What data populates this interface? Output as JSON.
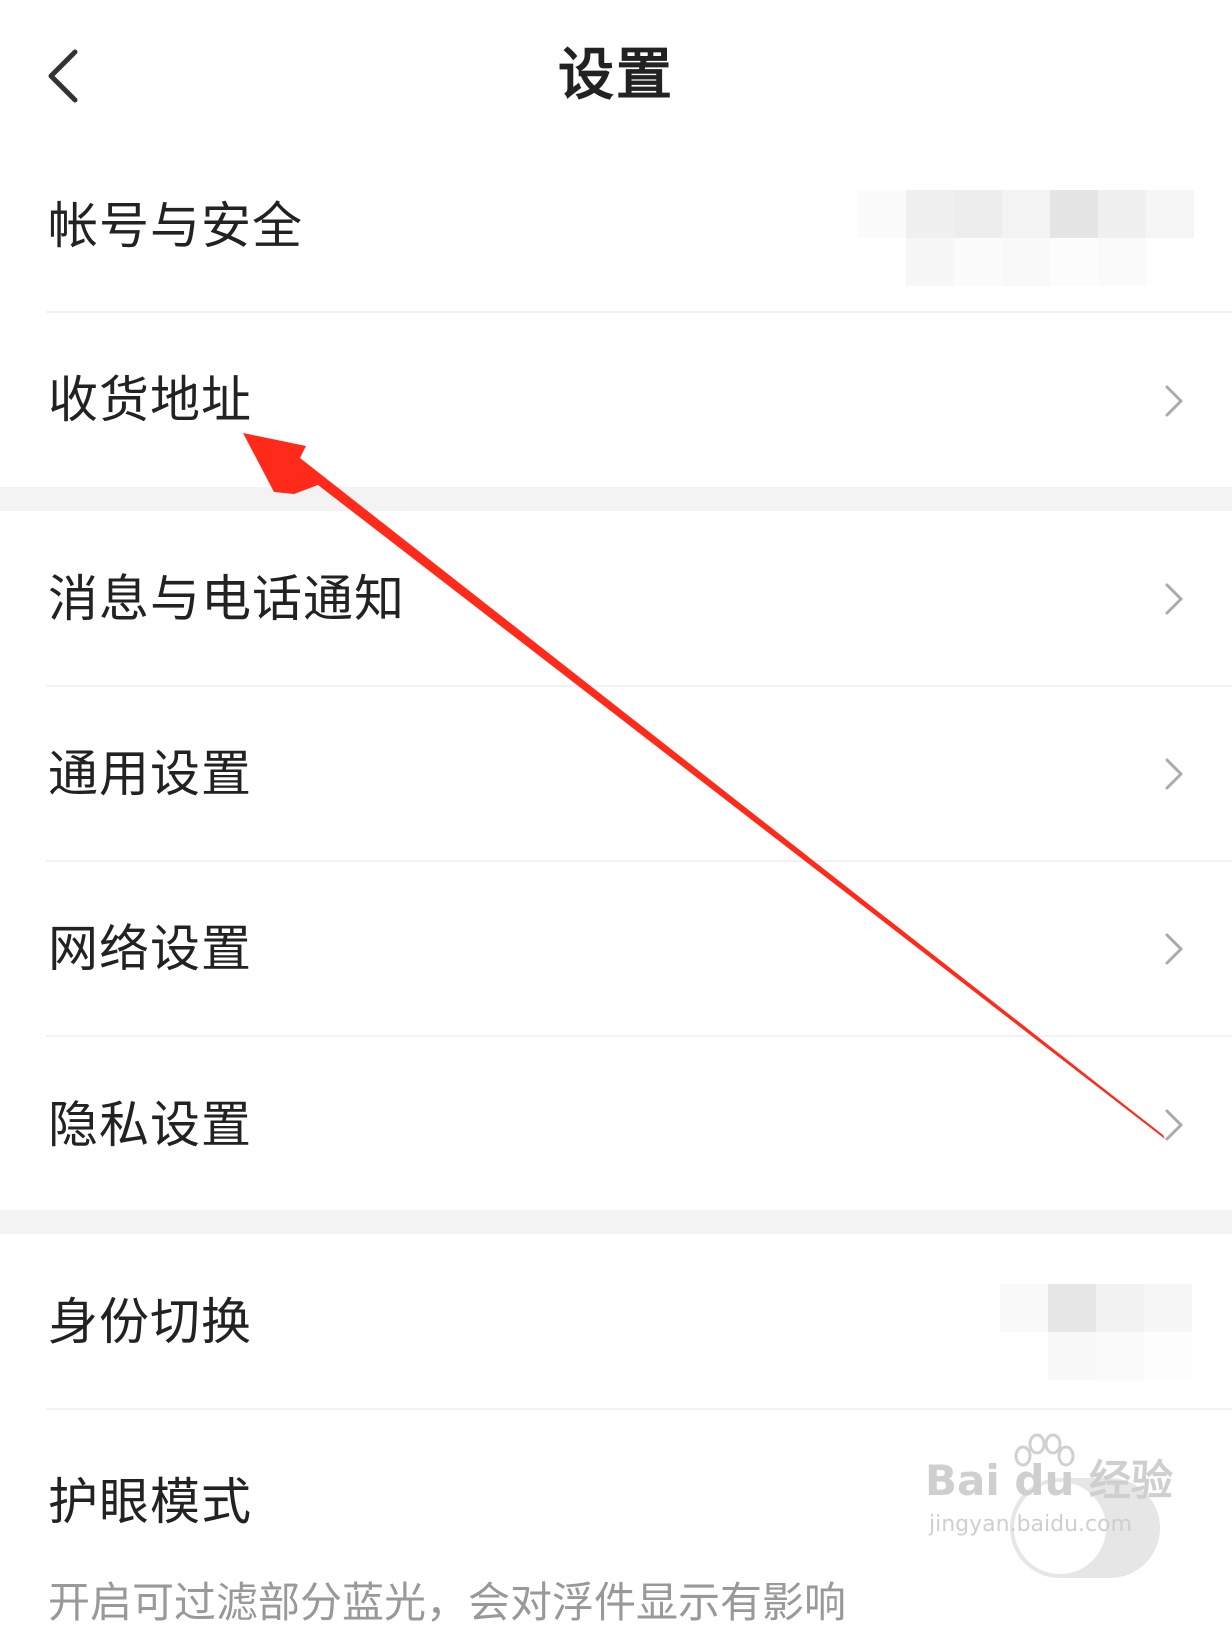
{
  "header": {
    "title": "设置",
    "back_icon": "chevron-left-icon"
  },
  "sections": [
    {
      "items": [
        {
          "label": "帐号与安全",
          "value": "blurred",
          "icon": "none"
        },
        {
          "label": "收货地址",
          "icon": "chevron-right-icon"
        }
      ]
    },
    {
      "items": [
        {
          "label": "消息与电话通知",
          "icon": "chevron-right-icon"
        },
        {
          "label": "通用设置",
          "icon": "chevron-right-icon"
        },
        {
          "label": "网络设置",
          "icon": "chevron-right-icon"
        },
        {
          "label": "隐私设置",
          "icon": "chevron-right-icon"
        }
      ]
    },
    {
      "items": [
        {
          "label": "身份切换",
          "value": "blurred",
          "icon": "none"
        },
        {
          "label": "护眼模式",
          "subtitle": "开启可过滤部分蓝光，会对浮件显示有影响",
          "toggle_on": false
        }
      ]
    }
  ],
  "watermark": {
    "brand": "Bai du 经验",
    "url": "jingyan.baidu.com"
  },
  "annotation": {
    "type": "red-arrow",
    "color": "#ff2a1a",
    "points_to": "收货地址"
  },
  "colors": {
    "background": "#ffffff",
    "section_gap": "#f3f3f3",
    "text": "#222222",
    "chevron": "#aaaaaa",
    "arrow": "#ff2a1a"
  }
}
